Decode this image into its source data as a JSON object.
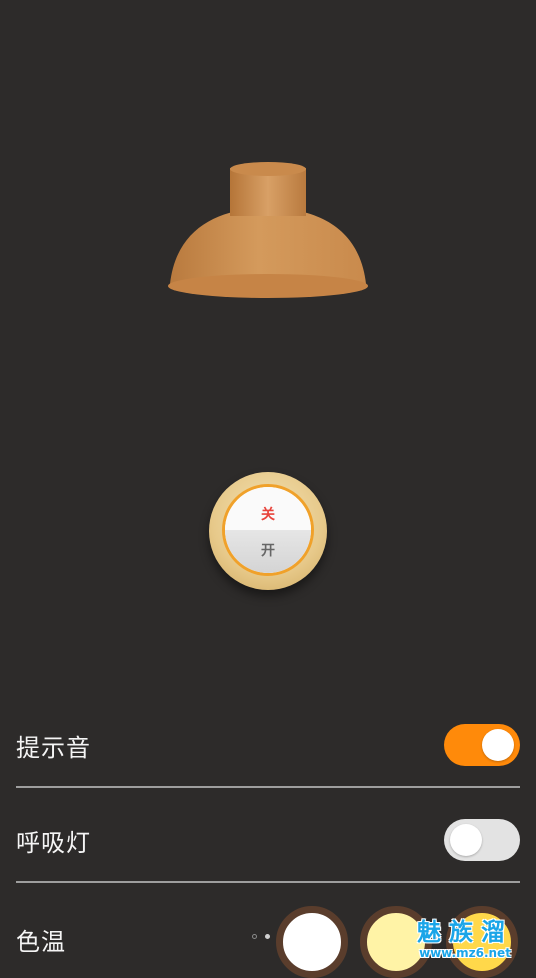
{
  "switch": {
    "off_label": "关",
    "on_label": "开"
  },
  "settings": {
    "sound": {
      "label": "提示音",
      "enabled": true
    },
    "breathing_light": {
      "label": "呼吸灯",
      "enabled": false
    },
    "color_temp": {
      "label": "色温",
      "page_dots": 3,
      "active_dot": 1,
      "swatches": [
        "#ffffff",
        "#fff3a6",
        "#ffd84a"
      ]
    }
  },
  "watermark": {
    "main": "魅族溜",
    "sub": "www.mz6.net"
  },
  "colors": {
    "background": "#2d2b2a",
    "lamp_shade": "#c98a4c",
    "accent_toggle": "#ff8a0a",
    "switch_off_text": "#e8433b"
  }
}
